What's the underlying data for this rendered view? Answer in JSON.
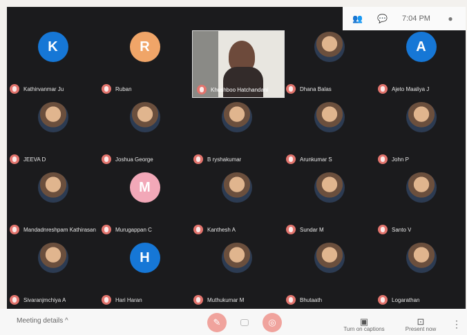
{
  "topbar": {
    "time": "7:04 PM",
    "icons": [
      "people-icon",
      "chat-icon",
      "user-icon"
    ]
  },
  "video": {
    "name": "Khushboo Hatchandani"
  },
  "participants": [
    {
      "name": "Kathirvanmar Ju",
      "initial": "K",
      "color": "#1677d6",
      "kind": "initial"
    },
    {
      "name": "Ruban",
      "initial": "R",
      "color": "#f0a568",
      "kind": "initial"
    },
    {
      "name": "Dhana Balas",
      "kind": "photo"
    },
    {
      "name": "Ajeto Maaliya J",
      "initial": "A",
      "color": "#1677d6",
      "kind": "initial"
    },
    {
      "name": "JEEVA D",
      "kind": "photo"
    },
    {
      "name": "Joshua George",
      "kind": "photo"
    },
    {
      "name": "B ryshakumar",
      "kind": "photo"
    },
    {
      "name": "Arunkumar S",
      "kind": "photo"
    },
    {
      "name": "John P",
      "kind": "photo"
    },
    {
      "name": "Mandadnreshpam Kathirasan",
      "kind": "photo"
    },
    {
      "name": "Murugappan C",
      "initial": "M",
      "color": "#f2a8b8",
      "kind": "initial"
    },
    {
      "name": "Kanthesh A",
      "kind": "photo"
    },
    {
      "name": "Sundar M",
      "kind": "photo"
    },
    {
      "name": "Santo V",
      "kind": "photo"
    },
    {
      "name": "Sivaranjmchiya A",
      "kind": "photo"
    },
    {
      "name": "Hari Haran",
      "initial": "H",
      "color": "#1677d6",
      "kind": "initial"
    },
    {
      "name": "Muthukumar M",
      "kind": "photo"
    },
    {
      "name": "Bhutaath",
      "kind": "photo"
    },
    {
      "name": "Logarathan",
      "kind": "photo"
    }
  ],
  "bottom": {
    "meeting_label": "Meeting details",
    "turn_on_captions": "Turn on captions",
    "present_now": "Present now"
  },
  "colors": {
    "bg": "#1b1b1d",
    "mic_muted": "#e2746d"
  }
}
